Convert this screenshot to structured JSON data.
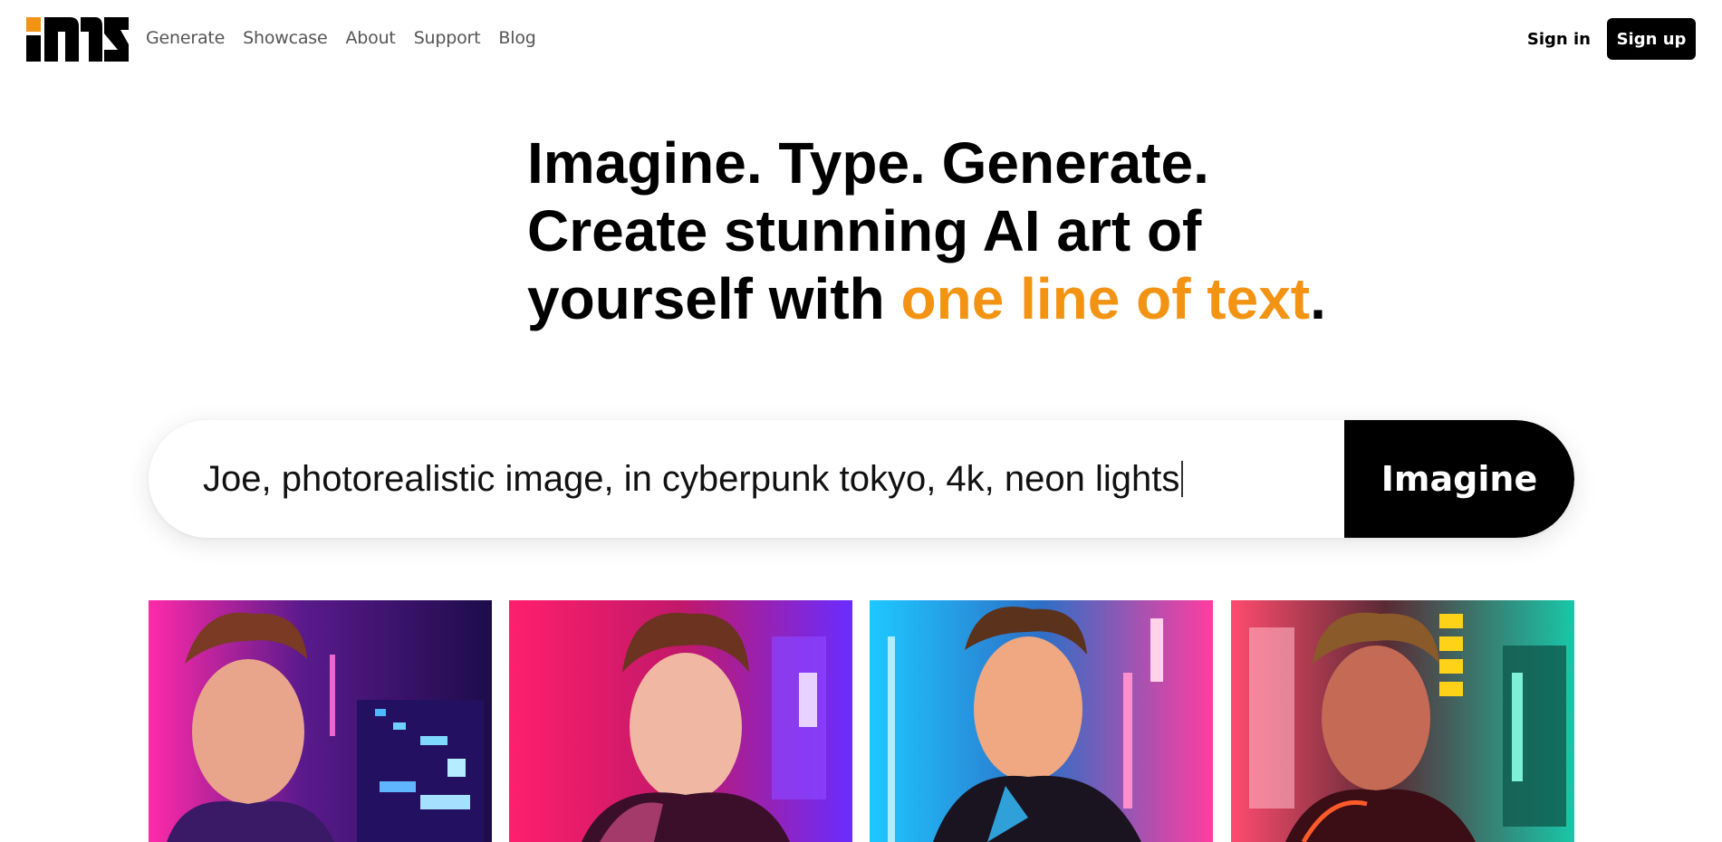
{
  "brand": {
    "logo_name": "mk-logo",
    "accent_color": "#f39314"
  },
  "nav": {
    "items": [
      {
        "label": "Generate"
      },
      {
        "label": "Showcase"
      },
      {
        "label": "About"
      },
      {
        "label": "Support"
      },
      {
        "label": "Blog"
      }
    ]
  },
  "auth": {
    "signin_label": "Sign in",
    "signup_label": "Sign up"
  },
  "hero": {
    "line1": "Imagine. Type. Generate.",
    "line2": "Create stunning AI art of",
    "line3_prefix": "yourself with ",
    "line3_highlight": "one line of text",
    "line3_suffix": "."
  },
  "prompt": {
    "value": "Joe, photorealistic image, in cyberpunk tokyo, 4k, neon lights",
    "button_label": "Imagine"
  },
  "gallery": {
    "images": [
      {
        "name": "neon-portrait-1",
        "palette": [
          "#ff2aa8",
          "#2a0a5e",
          "#4fb7ff"
        ]
      },
      {
        "name": "neon-portrait-2",
        "palette": [
          "#ff1f6b",
          "#7a2cff",
          "#ffffff"
        ]
      },
      {
        "name": "neon-portrait-3",
        "palette": [
          "#1ec8ff",
          "#ff3da0",
          "#0b3a7a"
        ]
      },
      {
        "name": "neon-portrait-4",
        "palette": [
          "#ff4b6e",
          "#19c7a8",
          "#ffd21a"
        ]
      }
    ]
  }
}
